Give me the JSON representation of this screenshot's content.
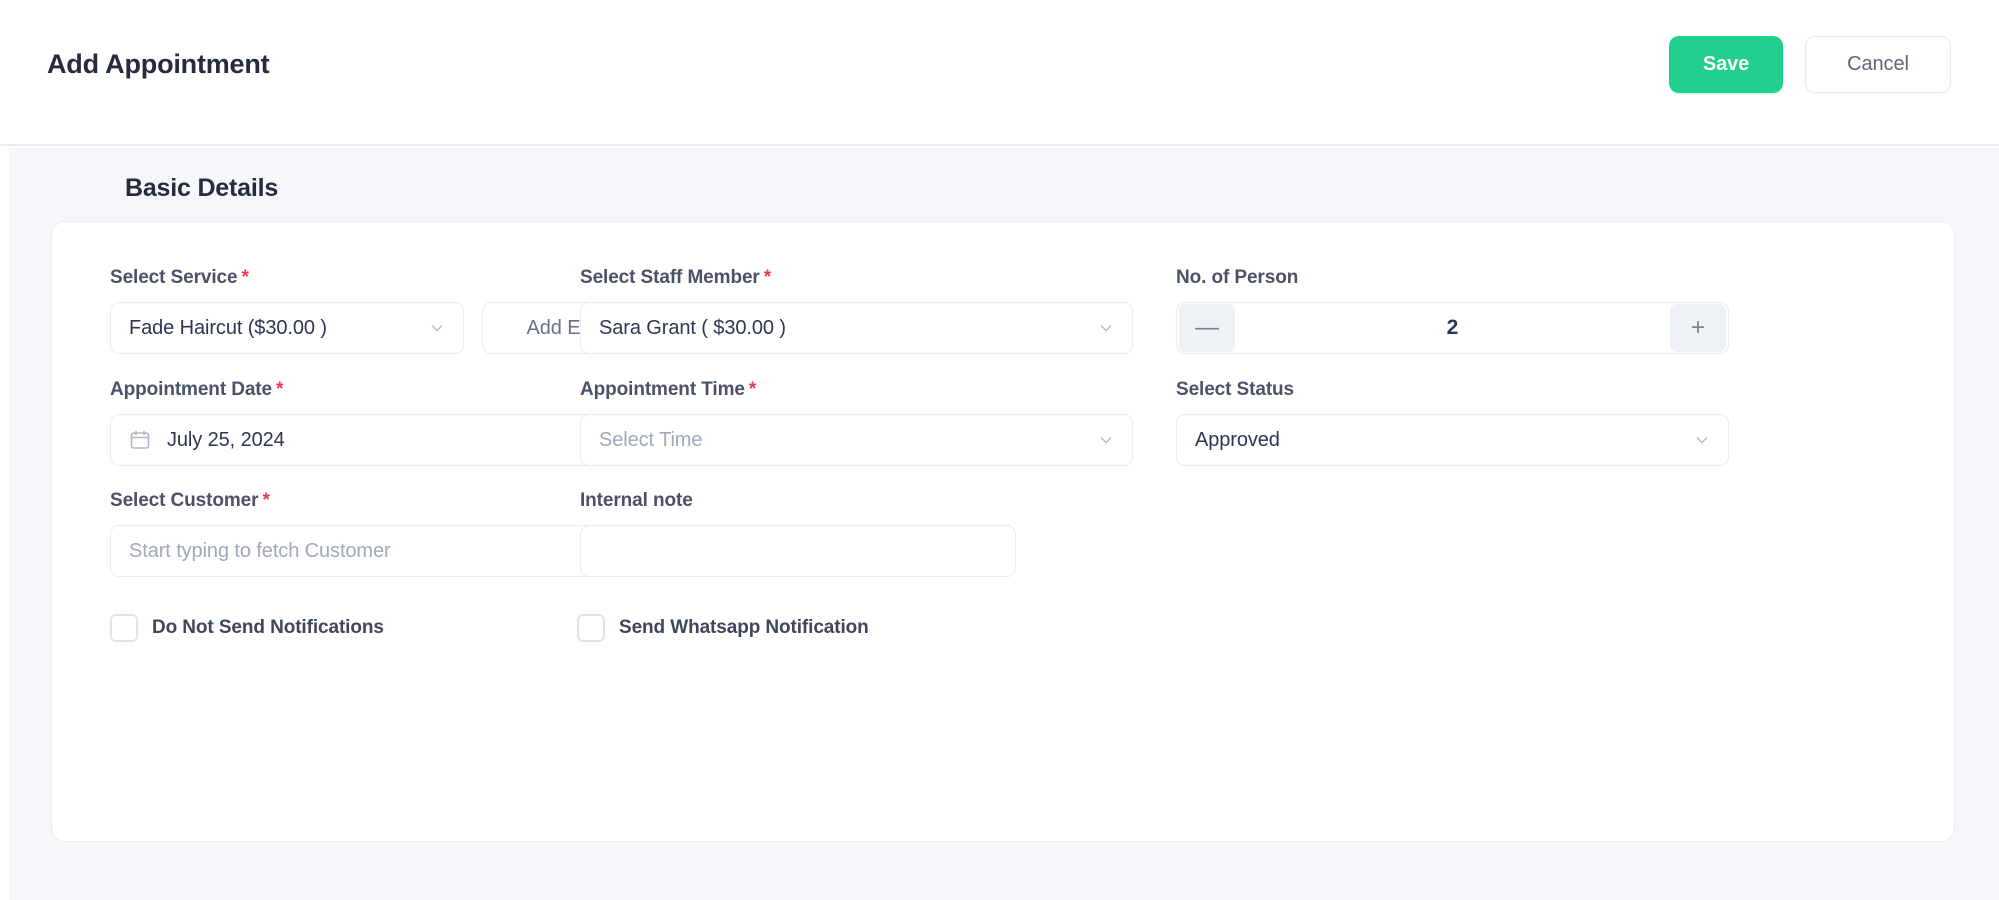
{
  "header": {
    "title": "Add Appointment",
    "save_label": "Save",
    "cancel_label": "Cancel",
    "save_color": "#23cf8e"
  },
  "section": {
    "title": "Basic Details"
  },
  "form": {
    "service": {
      "label": "Select Service",
      "required": "*",
      "value": "Fade Haircut ($30.00 )"
    },
    "add_extra": {
      "label": "Add Extra"
    },
    "staff": {
      "label": "Select Staff Member",
      "required": "*",
      "value": "Sara Grant ( $30.00 )"
    },
    "person": {
      "label": "No. of Person",
      "value": "2",
      "decrement": "—",
      "increment": "+"
    },
    "date": {
      "label": "Appointment Date",
      "required": "*",
      "value": "July 25, 2024"
    },
    "time": {
      "label": "Appointment Time",
      "required": "*",
      "placeholder": "Select Time",
      "value": ""
    },
    "status": {
      "label": "Select Status",
      "value": "Approved"
    },
    "customer": {
      "label": "Select Customer",
      "required": "*",
      "placeholder": "Start typing to fetch Customer",
      "value": ""
    },
    "note": {
      "label": "Internal note",
      "placeholder": "",
      "value": ""
    },
    "no_notifications": {
      "label": "Do Not Send Notifications",
      "checked": false
    },
    "whatsapp": {
      "label": "Send Whatsapp Notification",
      "checked": false
    }
  }
}
